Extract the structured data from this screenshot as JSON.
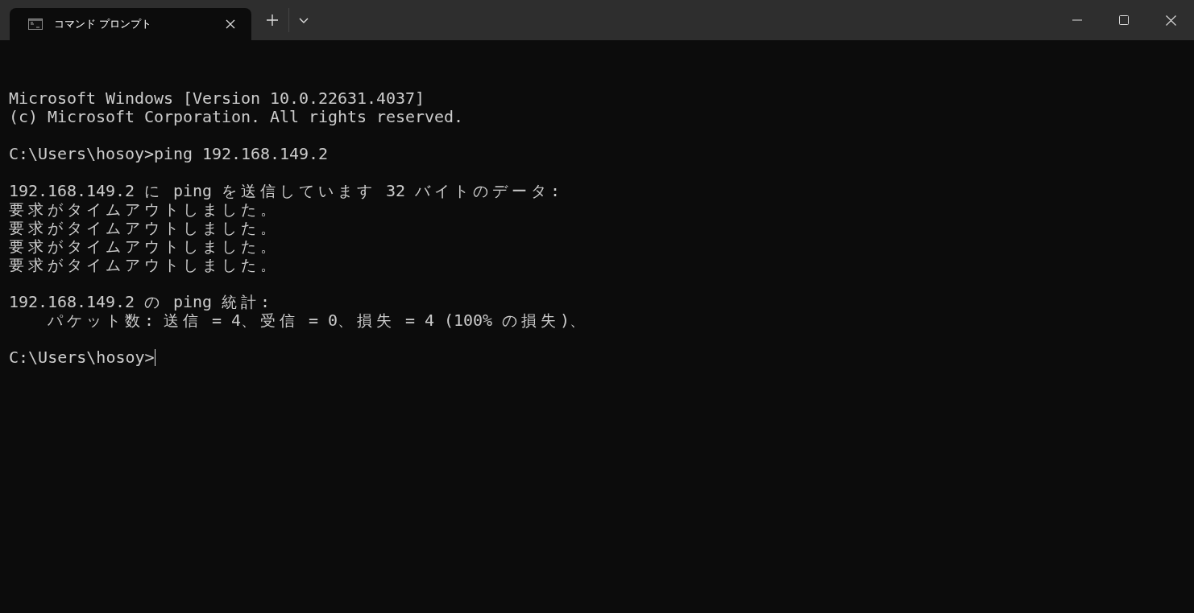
{
  "tabs": [
    {
      "title": "コマンド プロンプト",
      "selected": true
    }
  ],
  "terminal": {
    "blocks": [
      [
        "Microsoft Windows [Version 10.0.22631.4037]",
        "(c) Microsoft Corporation. All rights reserved."
      ],
      [
        "C:\\Users\\hosoy>ping 192.168.149.2"
      ],
      [
        "192.168.149.2 に ping を送信しています 32 バイトのデータ:",
        "要求がタイムアウトしました。",
        "要求がタイムアウトしました。",
        "要求がタイムアウトしました。",
        "要求がタイムアウトしました。"
      ],
      [
        "192.168.149.2 の ping 統計:",
        "    パケット数: 送信 = 4、受信 = 0、損失 = 4 (100% の損失)、"
      ]
    ],
    "prompt": "C:\\Users\\hosoy>",
    "cursor": true
  }
}
